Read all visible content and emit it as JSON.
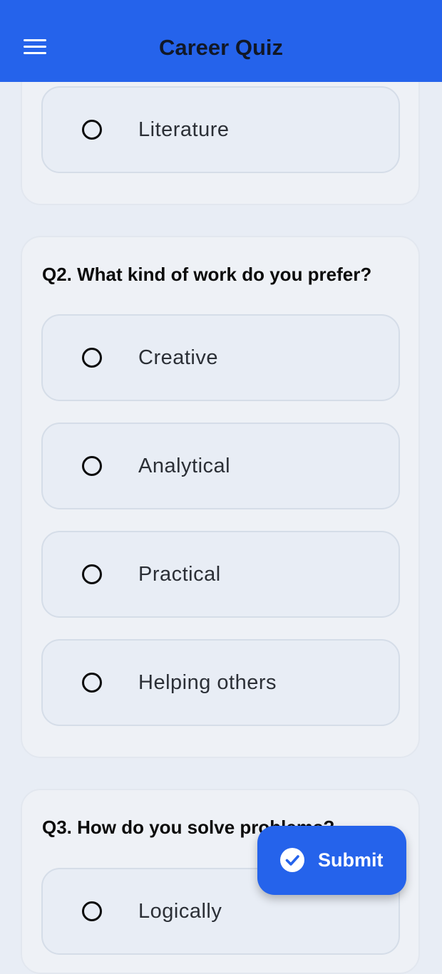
{
  "app": {
    "title": "Career Quiz",
    "menu_icon": "menu-icon"
  },
  "questions": [
    {
      "question": "",
      "options": [
        "Literature"
      ]
    },
    {
      "question": "Q2. What kind of work do you prefer?",
      "options": [
        "Creative",
        "Analytical",
        "Practical",
        "Helping others"
      ]
    },
    {
      "question": "Q3. How do you solve problems?",
      "options": [
        "Logically"
      ]
    }
  ],
  "submit": {
    "label": "Submit",
    "icon": "check-circle-icon"
  },
  "colors": {
    "primary": "#2563eb",
    "background": "#e8edf5",
    "text": "#0b0b0b"
  }
}
